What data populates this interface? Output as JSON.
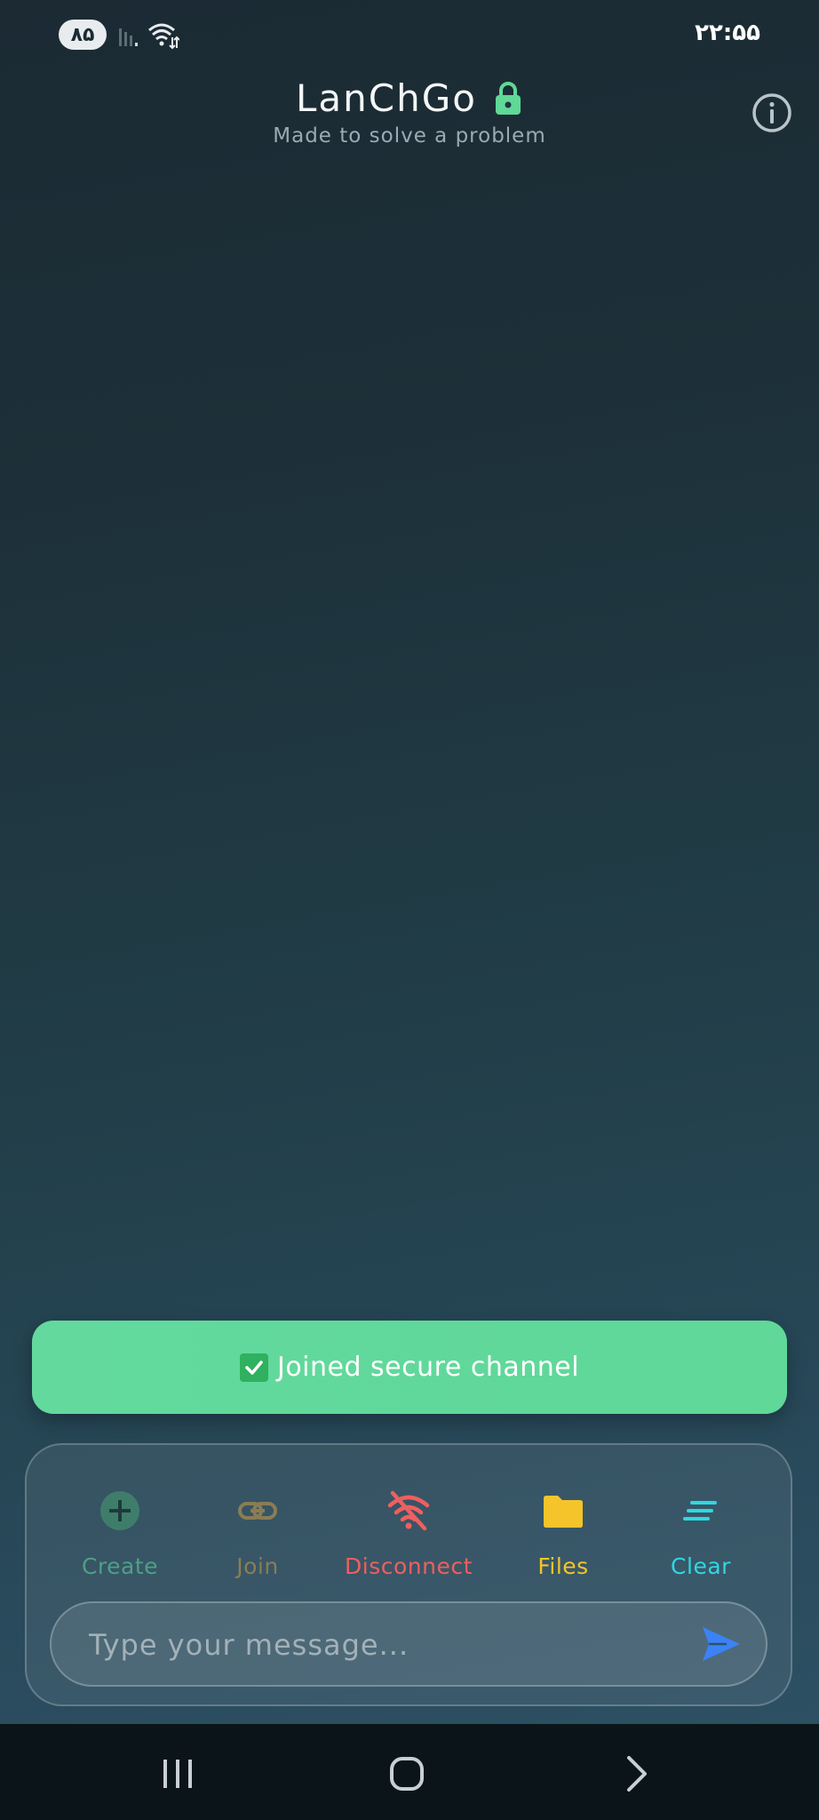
{
  "status_bar": {
    "battery": "۸۵",
    "time": "۲۲:۵۵"
  },
  "header": {
    "title": "LanChGo",
    "subtitle": "Made to solve a problem"
  },
  "toast": {
    "text": "Joined secure channel"
  },
  "actions": [
    {
      "label": "Create",
      "color": "#4f9f86"
    },
    {
      "label": "Join",
      "color": "#8a7d55"
    },
    {
      "label": "Disconnect",
      "color": "#ef5f5f"
    },
    {
      "label": "Files",
      "color": "#f4c42a"
    },
    {
      "label": "Clear",
      "color": "#2fd7e2"
    }
  ],
  "composer": {
    "placeholder": "Type your message...",
    "value": ""
  },
  "colors": {
    "accent_green": "#63d99e",
    "send_blue": "#3b82f6"
  },
  "icons": {
    "title": "lock-icon",
    "header_right": "info-icon",
    "toast": "check-mark-icon",
    "send": "send-icon"
  }
}
